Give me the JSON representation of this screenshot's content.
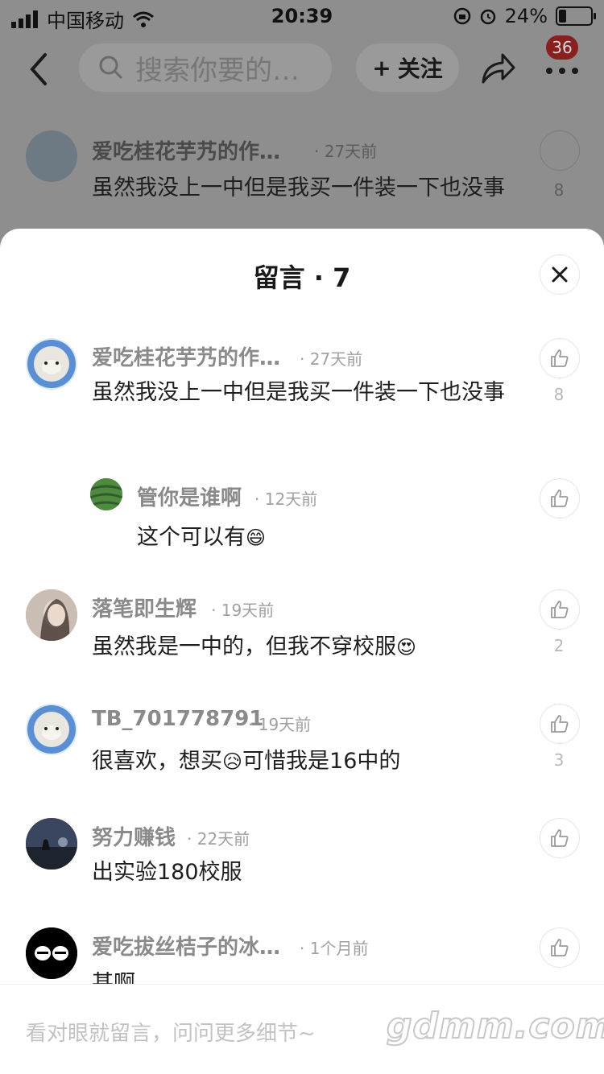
{
  "status_bar": {
    "carrier": "中国移动",
    "time": "20:39",
    "battery": "24%"
  },
  "top_bar": {
    "search_placeholder": "搜索你要的…",
    "follow_label": "关注",
    "notification_count": "36"
  },
  "background_comment": {
    "user": "爱吃桂花芋艿的作…",
    "time": "· 27天前",
    "text": "虽然我没上一中但是我买一件装一下也没事",
    "likes": "8"
  },
  "sheet": {
    "title": "留言 · 7",
    "comments": [
      {
        "user": "爱吃桂花芋艿的作…",
        "time": "· 27天前",
        "text": "虽然我没上一中但是我买一件装一下也没事",
        "likes": "8"
      },
      {
        "user": "管你是谁啊",
        "time": "· 12天前",
        "text": "这个可以有",
        "emoji": "😄",
        "likes": ""
      },
      {
        "user": "落笔即生辉",
        "time": "· 19天前",
        "text": "虽然我是一中的，但我不穿校服",
        "emoji": "😍",
        "likes": "2"
      },
      {
        "user": "TB_701778791",
        "time": "· 19天前",
        "text_before": "很喜欢，想买",
        "emoji": "😥",
        "text_after": "可惜我是16中的",
        "likes": "3"
      },
      {
        "user": "努力赚钱",
        "time": "· 22天前",
        "text": "出实验180校服",
        "likes": ""
      },
      {
        "user": "爱吃拔丝桔子的冰…",
        "time": "· 1个月前",
        "text": "甚啊",
        "likes": ""
      }
    ]
  },
  "footer": {
    "placeholder": "看对眼就留言，问问更多细节~",
    "watermark": "gdmm.com"
  }
}
